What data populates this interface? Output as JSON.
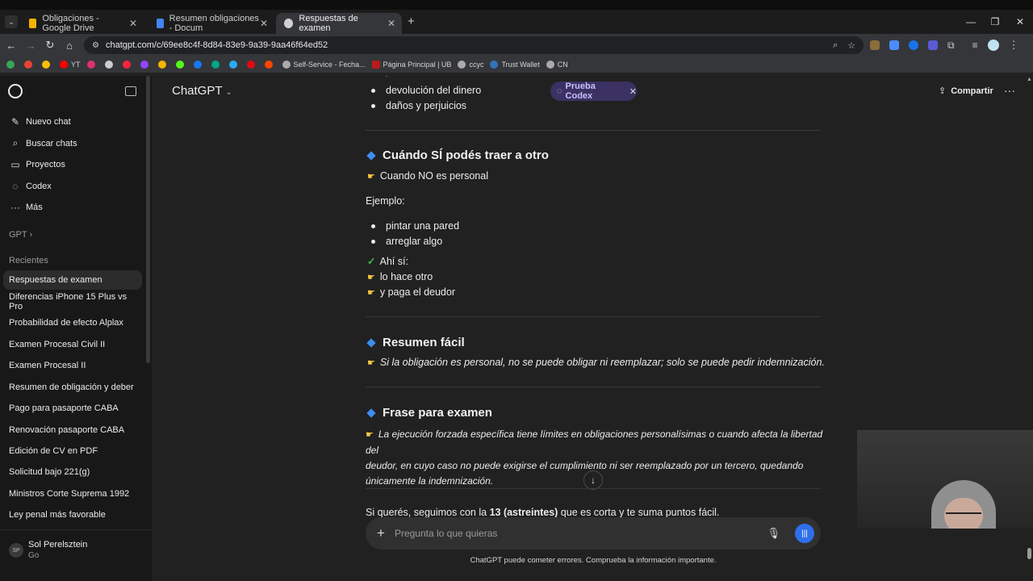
{
  "browser": {
    "tabs": [
      {
        "title": "Obligaciones - Google Drive",
        "color": "#f4b400"
      },
      {
        "title": "Resumen obligaciones - Docum",
        "color": "#4285f4"
      },
      {
        "title": "Respuestas de examen",
        "color": "#d0d0d0"
      }
    ],
    "url": "chatgpt.com/c/69ee8c4f-8d84-83e9-9a39-9aa46f64ed52",
    "bookmarks": [
      {
        "label": "",
        "color": "#34a853"
      },
      {
        "label": "",
        "color": "#ea4335"
      },
      {
        "label": "",
        "color": "#fbbc05"
      },
      {
        "label": "YT",
        "color": "#ff0000"
      },
      {
        "label": "",
        "color": "#e1306c"
      },
      {
        "label": "",
        "color": "#cccccc"
      },
      {
        "label": "",
        "color": "#fa243c"
      },
      {
        "label": "",
        "color": "#9146ff"
      },
      {
        "label": "",
        "color": "#f4b400"
      },
      {
        "label": "",
        "color": "#53fc18"
      },
      {
        "label": "",
        "color": "#1877f2"
      },
      {
        "label": "",
        "color": "#00a884"
      },
      {
        "label": "",
        "color": "#2aabee"
      },
      {
        "label": "",
        "color": "#e50914"
      },
      {
        "label": "",
        "color": "#ff4500"
      },
      {
        "label": "",
        "color": "#aaaaaa"
      },
      {
        "label": "Self-Service - Fecha...",
        "color": "#aaaaaa"
      },
      {
        "label": "Página Principal | UB",
        "color": "#b71c1c"
      },
      {
        "label": "ccyc",
        "color": "#aaaaaa"
      },
      {
        "label": "Trust Wallet",
        "color": "#3375bb"
      },
      {
        "label": "CN",
        "color": "#aaaaaa"
      }
    ]
  },
  "sidebar": {
    "nav": [
      {
        "label": "Nuevo chat",
        "icon": "edit-icon"
      },
      {
        "label": "Buscar chats",
        "icon": "search-icon"
      },
      {
        "label": "Proyectos",
        "icon": "folder-icon"
      },
      {
        "label": "Codex",
        "icon": "codex-icon"
      },
      {
        "label": "Más",
        "icon": "more-icon"
      }
    ],
    "gpt_label": "GPT",
    "recents_label": "Recientes",
    "chats": [
      "Respuestas de examen",
      "Diferencias iPhone 15 Plus vs Pro",
      "Probabilidad de efecto Alplax",
      "Examen Procesal Civil II",
      "Examen Procesal II",
      "Resumen de obligación y deber",
      "Pago para pasaporte CABA",
      "Renovación pasaporte CABA",
      "Edición de CV en PDF",
      "Solicitud bajo 221(g)",
      "Ministros Corte Suprema 1992",
      "Ley penal más favorable"
    ],
    "user": {
      "name": "Sol Perelsztein",
      "plan": "Go",
      "initials": "SP"
    }
  },
  "header": {
    "title": "ChatGPT",
    "codex_pill": "Prueba Codex",
    "share": "Compartir"
  },
  "content": {
    "top_bullets": [
      "devolución del dinero",
      "daños y perjuicios"
    ],
    "section1": {
      "heading": "Cuándo SÍ podés traer a otro",
      "line1": "Cuando NO es personal",
      "example_label": "Ejemplo:",
      "bullets": [
        "pintar una pared",
        "arreglar algo"
      ],
      "check": "Ahí sí:",
      "pt1": "lo hace otro",
      "pt2": "y paga el deudor"
    },
    "section2": {
      "heading": "Resumen fácil",
      "text": "Si la obligación es personal, no se puede obligar ni reemplazar; solo se puede pedir indemnización."
    },
    "section3": {
      "heading": "Frase para examen",
      "line1": "La ejecución forzada específica tiene límites en obligaciones personalísimas o cuando afecta la libertad del",
      "line2": "deudor, en cuyo caso no puede exigirse el cumplimiento ni ser reemplazado por un tercero, quedando",
      "line3": "únicamente la indemnización."
    },
    "closing_pre": "Si querés, seguimos con la ",
    "closing_bold": "13 (astreintes)",
    "closing_post": " que es corta y te suma puntos fácil."
  },
  "composer": {
    "placeholder": "Pregunta lo que quieras"
  },
  "footer": "ChatGPT puede cometer errores. Comprueba la información importante."
}
